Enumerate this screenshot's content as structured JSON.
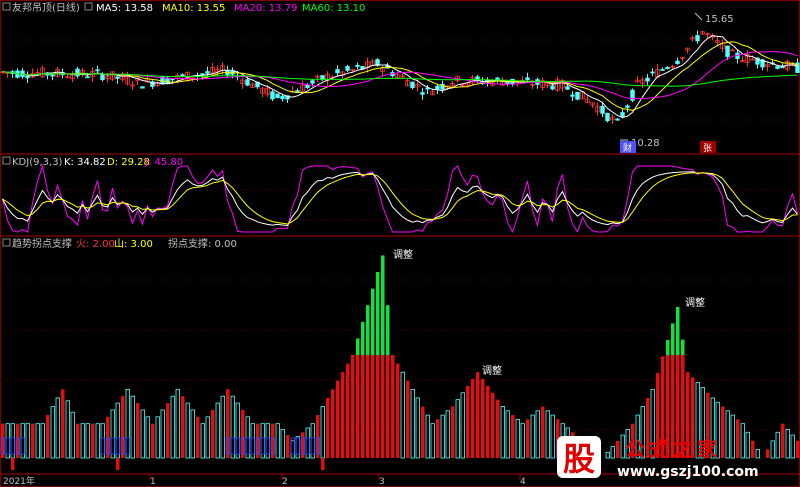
{
  "chart_data": [
    {
      "type": "candlestick",
      "panel": "main",
      "title": "友邦吊顶(日线)",
      "legend": [
        {
          "name": "MA5",
          "label": "MA5: 13.58",
          "color": "#ffffff"
        },
        {
          "name": "MA10",
          "label": "MA10: 13.55",
          "color": "#ffff00"
        },
        {
          "name": "MA20",
          "label": "MA20: 13.79",
          "color": "#ff00ff"
        },
        {
          "name": "MA60",
          "label": "MA60: 13.10",
          "color": "#00ff00"
        }
      ],
      "annotations": {
        "high_label": "15.65",
        "low_label": "10.28",
        "badge_left": "财",
        "badge_right": "张"
      },
      "price_range": [
        9.8,
        16.2
      ],
      "high": 15.65,
      "low": 10.28,
      "colors": {
        "up": "#ff3232",
        "down": "#54ffff"
      }
    },
    {
      "type": "line",
      "panel": "indicator",
      "title": "KDJ(9,3,3)",
      "legend": [
        {
          "name": "K",
          "label": "K: 34.82",
          "color": "#ffffff"
        },
        {
          "name": "D",
          "label": "D: 29.28",
          "color": "#ffff00"
        },
        {
          "name": "J",
          "label": "J: 45.80",
          "color": "#ff00ff"
        }
      ],
      "ylim": [
        -10,
        110
      ]
    },
    {
      "type": "bar",
      "panel": "indicator",
      "title": "趋势拐点支撑",
      "legend": [
        {
          "name": "火",
          "label": "火: 2.00",
          "color": "#ff3232"
        },
        {
          "name": "山",
          "label": "山: 3.00",
          "color": "#ffff00"
        },
        {
          "name": "拐点支撑",
          "label": "拐点支撑: 0.00",
          "color": "#c0c0c0"
        }
      ],
      "labels": [
        "调整",
        "调整",
        "调整"
      ],
      "x_ticks": [
        "2021年",
        "1",
        "2",
        "3",
        "4"
      ],
      "ylim": [
        0,
        12
      ]
    }
  ],
  "watermark": {
    "glyph": "股",
    "text": "公式之家",
    "url": "www.gszj100.com"
  }
}
